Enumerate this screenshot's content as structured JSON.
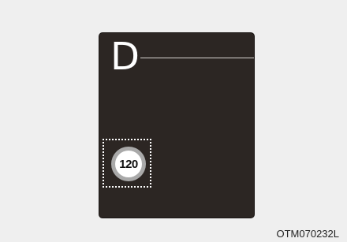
{
  "display": {
    "gear": "D",
    "speed_limit_sign": {
      "value": "120",
      "icon": "speed-limit-sign-icon"
    }
  },
  "caption": "OTM070232L",
  "colors": {
    "background": "#efefef",
    "display_bg": "#2c2623",
    "sign_ring": "#a9a9a9",
    "highlight_border": "#ffffff"
  }
}
